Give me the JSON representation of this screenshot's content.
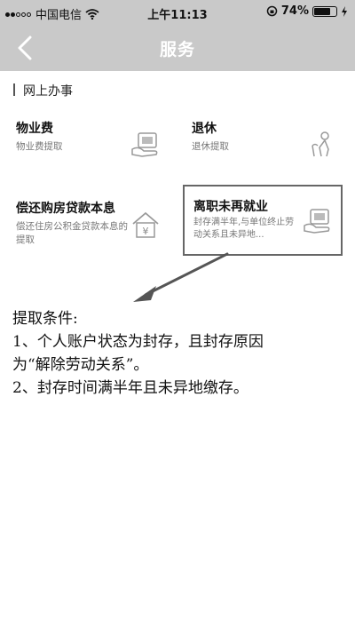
{
  "status_bar": {
    "carrier": "中国电信",
    "time": "上午11:13",
    "battery_percent": "74%",
    "battery_level": 0.74
  },
  "nav": {
    "title": "服务"
  },
  "section": {
    "title": "网上办事"
  },
  "services": [
    {
      "title": "物业费",
      "desc": "物业费提取",
      "icon": "receipt-hand-icon"
    },
    {
      "title": "退休",
      "desc": "退休提取",
      "icon": "person-cane-icon"
    },
    {
      "title": "偿还购房贷款本息",
      "desc": "偿还住房公积金贷款本息的提取",
      "icon": "house-yuan-icon"
    },
    {
      "title": "离职未再就业",
      "desc": "封存满半年,与单位终止劳动关系且未异地...",
      "icon": "receipt-hand-icon"
    }
  ],
  "conditions": {
    "heading": "提取条件:",
    "lines": [
      "1、个人账户状态为封存，且封存原因",
      "为“解除劳动关系”。",
      "2、封存时间满半年且未异地缴存。"
    ]
  }
}
